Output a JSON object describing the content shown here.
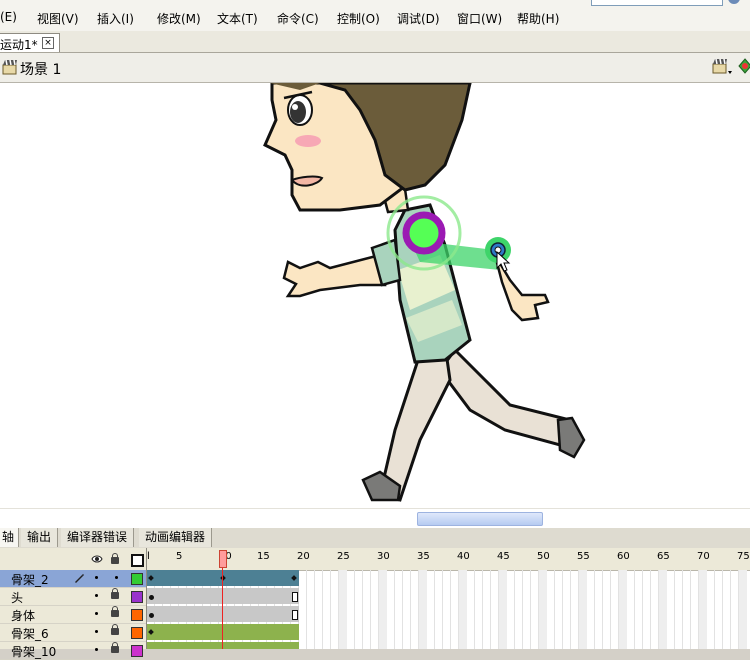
{
  "menu": [
    "(E)",
    "视图(V)",
    "插入(I)",
    "修改(M)",
    "文本(T)",
    "命令(C)",
    "控制(O)",
    "调试(D)",
    "窗口(W)",
    "帮助(H)"
  ],
  "doc_tab": {
    "title": "运动1*",
    "close": "×"
  },
  "scene": {
    "label": "场景 1"
  },
  "panel_tabs": [
    "轴",
    "输出",
    "编译器错误",
    "动画编辑器"
  ],
  "timeline": {
    "current_frame": 10,
    "ruler": [
      "l",
      "5",
      "10",
      "15",
      "20",
      "25",
      "30",
      "35",
      "40",
      "45",
      "50",
      "55",
      "60",
      "65",
      "70",
      "75"
    ],
    "layers": [
      {
        "name": "骨架_2",
        "color": "#33cc33",
        "selected": true
      },
      {
        "name": "头",
        "color": "#9933cc",
        "selected": false
      },
      {
        "name": "身体",
        "color": "#ff6600",
        "selected": false
      },
      {
        "name": "骨架_6",
        "color": "#ff6600",
        "selected": false
      },
      {
        "name": "骨架_10",
        "color": "#cc33cc",
        "selected": false
      }
    ]
  },
  "colors": {
    "armature_span": "#4d8094",
    "tween_span": "#8db24d",
    "static_span": "#c8c8c8",
    "selected_layer": "#8aa5d6",
    "bone_joint": "#9b1ab3",
    "bone_handle": "#55ff55"
  },
  "icons": [
    "eye-icon",
    "lock-icon",
    "outline-icon",
    "pencil-icon",
    "scene-clapper-icon",
    "edit-symbols-icon",
    "edit-scene-icon",
    "close-icon"
  ]
}
